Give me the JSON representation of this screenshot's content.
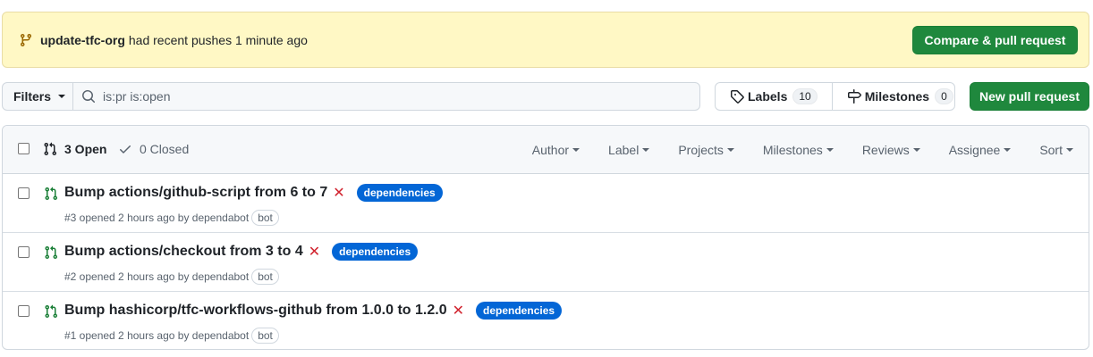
{
  "banner": {
    "branch": "update-tfc-org",
    "message": "had recent pushes 1 minute ago",
    "compare_button": "Compare & pull request"
  },
  "toolbar": {
    "filters_label": "Filters",
    "search_value": "is:pr is:open",
    "labels_label": "Labels",
    "labels_count": "10",
    "milestones_label": "Milestones",
    "milestones_count": "0",
    "new_pr_button": "New pull request"
  },
  "list_header": {
    "open_label": "3 Open",
    "closed_label": "0 Closed",
    "filters": [
      "Author",
      "Label",
      "Projects",
      "Milestones",
      "Reviews",
      "Assignee",
      "Sort"
    ]
  },
  "pull_requests": [
    {
      "title": "Bump actions/github-script from 6 to 7",
      "status_mark": "✕",
      "label": "dependencies",
      "meta": "#3 opened 2 hours ago by dependabot",
      "badge": "bot"
    },
    {
      "title": "Bump actions/checkout from 3 to 4",
      "status_mark": "✕",
      "label": "dependencies",
      "meta": "#2 opened 2 hours ago by dependabot",
      "badge": "bot"
    },
    {
      "title": "Bump hashicorp/tfc-workflows-github from 1.0.0 to 1.2.0",
      "status_mark": "✕",
      "label": "dependencies",
      "meta": "#1 opened 2 hours ago by dependabot",
      "badge": "bot"
    }
  ],
  "colors": {
    "banner_bg": "#fff8c5",
    "primary_green": "#1f883d",
    "open_green": "#1a7f37",
    "fail_red": "#d1242f",
    "label_blue": "#0366d6"
  }
}
